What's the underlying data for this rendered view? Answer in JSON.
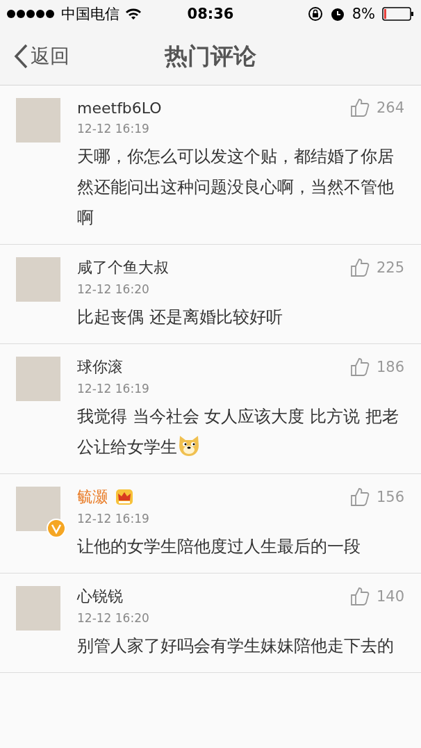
{
  "status_bar": {
    "carrier": "中国电信",
    "time": "08:36",
    "battery": "8%"
  },
  "nav": {
    "back": "返回",
    "title": "热门评论"
  },
  "comments": [
    {
      "user": "meetfb6LO",
      "time": "12-12 16:19",
      "likes": "264",
      "text": "天哪，你怎么可以发这个贴，都结婚了你居然还能问出这种问题没良心啊，当然不管他啊",
      "highlight": false,
      "crown": false,
      "verified": false,
      "emoji": false
    },
    {
      "user": "咸了个鱼大叔",
      "time": "12-12 16:20",
      "likes": "225",
      "text": "比起丧偶 还是离婚比较好听",
      "highlight": false,
      "crown": false,
      "verified": false,
      "emoji": false
    },
    {
      "user": "球你滚",
      "time": "12-12 16:19",
      "likes": "186",
      "text": "我觉得 当今社会 女人应该大度 比方说 把老公让给女学生",
      "highlight": false,
      "crown": false,
      "verified": false,
      "emoji": true
    },
    {
      "user": "毓灏",
      "time": "12-12 16:19",
      "likes": "156",
      "text": "让他的女学生陪他度过人生最后的一段",
      "highlight": true,
      "crown": true,
      "verified": true,
      "emoji": false
    },
    {
      "user": "心锐锐",
      "time": "12-12 16:20",
      "likes": "140",
      "text": "别管人家了好吗会有学生妹妹陪他走下去的",
      "highlight": false,
      "crown": false,
      "verified": false,
      "emoji": false
    }
  ]
}
